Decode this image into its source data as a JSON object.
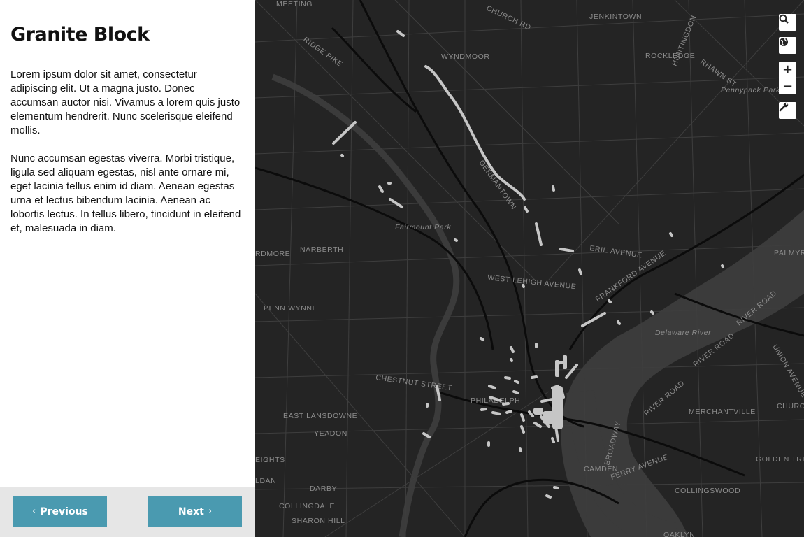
{
  "sidebar": {
    "title": "Granite Block",
    "paragraphs": [
      "Lorem ipsum dolor sit amet, consectetur adipiscing elit. Ut a magna justo. Donec accumsan auctor nisi. Vivamus a lorem quis justo elementum hendrerit. Nunc scelerisque eleifend mollis.",
      "Nunc accumsan egestas viverra. Morbi tristique, ligula sed aliquam egestas, nisl ante ornare mi, eget lacinia tellus enim id diam. Aenean egestas urna et lectus bibendum lacinia. Aenean ac lobortis lectus. In tellus libero, tincidunt in eleifend et, malesuada in diam."
    ],
    "previous_label": "Previous",
    "next_label": "Next"
  },
  "map": {
    "labels": {
      "meeting": "MEETING",
      "church_rd": "CHURCH RD",
      "jenkintown": "JENKINTOWN",
      "ridge_pike": "RIDGE PIKE",
      "wyndmoor": "WYNDMOOR",
      "rockledge": "ROCKLEDGE",
      "huntingdon": "HUNTINGDON",
      "rhawn_st": "RHAWN ST",
      "pennypack_park": "Pennypack Park",
      "germantown": "GERMANTOWN",
      "fairmount_park": "Fairmount Park",
      "ardmore": "RDMORE",
      "narberth": "NARBERTH",
      "erie_avenue": "ERIE AVENUE",
      "palmyra": "PALMYR",
      "west_lehigh": "WEST LEHIGH AVENUE",
      "frankford": "FRANKFORD AVENUE",
      "penn_wynne": "PENN WYNNE",
      "river_road_1": "RIVER ROAD",
      "delaware_river": "Delaware River",
      "river_road_2": "RIVER ROAD",
      "union_avenue": "UNION AVENUE",
      "chestnut_st": "CHESTNUT STREET",
      "philadelphia": "PHILADELPH",
      "east_lansdowne": "EAST LANSDOWNE",
      "river_road_3": "RIVER ROAD",
      "merchantville": "MERCHANTVILLE",
      "church": "CHURC",
      "yeadon": "YEADON",
      "broadway": "BROADWAY",
      "camden": "CAMDEN",
      "golden_triangle": "GOLDEN TRIANGLE",
      "heights": "EIGHTS",
      "aldan": "LDAN",
      "darby": "DARBY",
      "ferry_avenue": "FERRY AVENUE",
      "collingswood": "COLLINGSWOOD",
      "collingdale": "COLLINGDALE",
      "sharon_hill": "SHARON HILL",
      "oaklyn": "OAKLYN"
    },
    "controls": {
      "search_icon": "search-icon",
      "globe_icon": "globe-icon",
      "zoom_in": "+",
      "zoom_out": "−",
      "wrench_icon": "wrench-icon"
    },
    "colors": {
      "background": "#242424",
      "water": "#3b3b3b",
      "roads": "#3e3e3e",
      "highways": "#050505",
      "features": "#c6c6c6",
      "button": "#4a9ab0"
    }
  }
}
